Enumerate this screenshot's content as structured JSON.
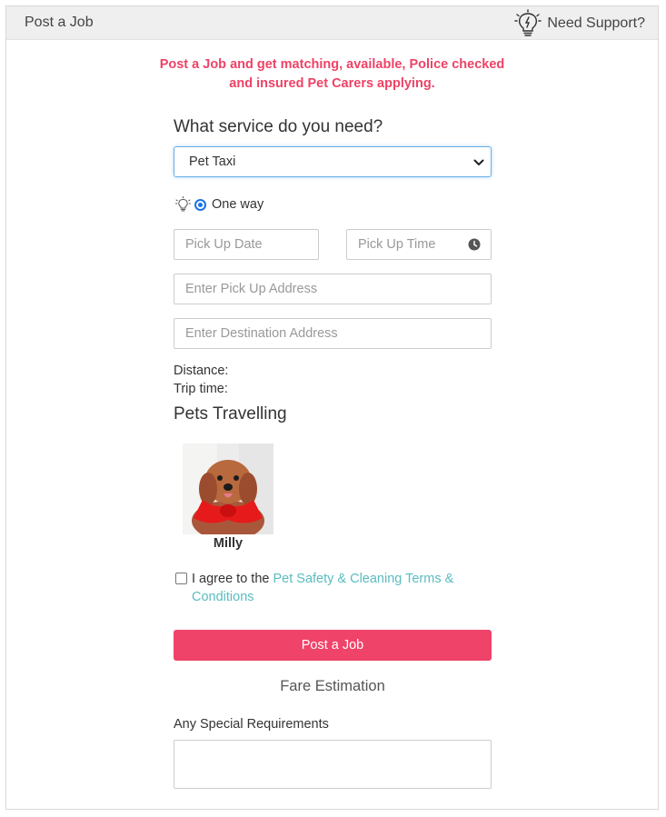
{
  "header": {
    "title": "Post a Job",
    "support_label": "Need Support?",
    "support_icon": "lightbulb-icon"
  },
  "tagline": {
    "line1": "Post a Job and get matching, available, Police checked",
    "line2": "and insured Pet Carers applying."
  },
  "form": {
    "service_question": "What service do you need?",
    "service_selected": "Pet Taxi",
    "trip_type": {
      "label": "One way",
      "selected": true,
      "icon": "lightbulb-icon"
    },
    "pickup_date_placeholder": "Pick Up Date",
    "pickup_time_placeholder": "Pick Up Time",
    "pickup_address_placeholder": "Enter Pick Up Address",
    "destination_placeholder": "Enter Destination Address",
    "distance_label": "Distance:",
    "trip_time_label": "Trip time:",
    "pets_heading": "Pets Travelling",
    "pets": [
      {
        "name": "Milly"
      }
    ],
    "agree_prefix": "I agree to the ",
    "agree_link": "Pet Safety & Cleaning Terms & Conditions",
    "agree_checked": false,
    "post_button": "Post a Job",
    "fare_estimation": "Fare Estimation",
    "special_requirements_label": "Any Special Requirements",
    "special_requirements_value": ""
  },
  "colors": {
    "accent_pink": "#f0436a",
    "tagline_pink": "#ee4266",
    "link_teal": "#5bbcc0",
    "focus_blue": "#66afe9"
  }
}
